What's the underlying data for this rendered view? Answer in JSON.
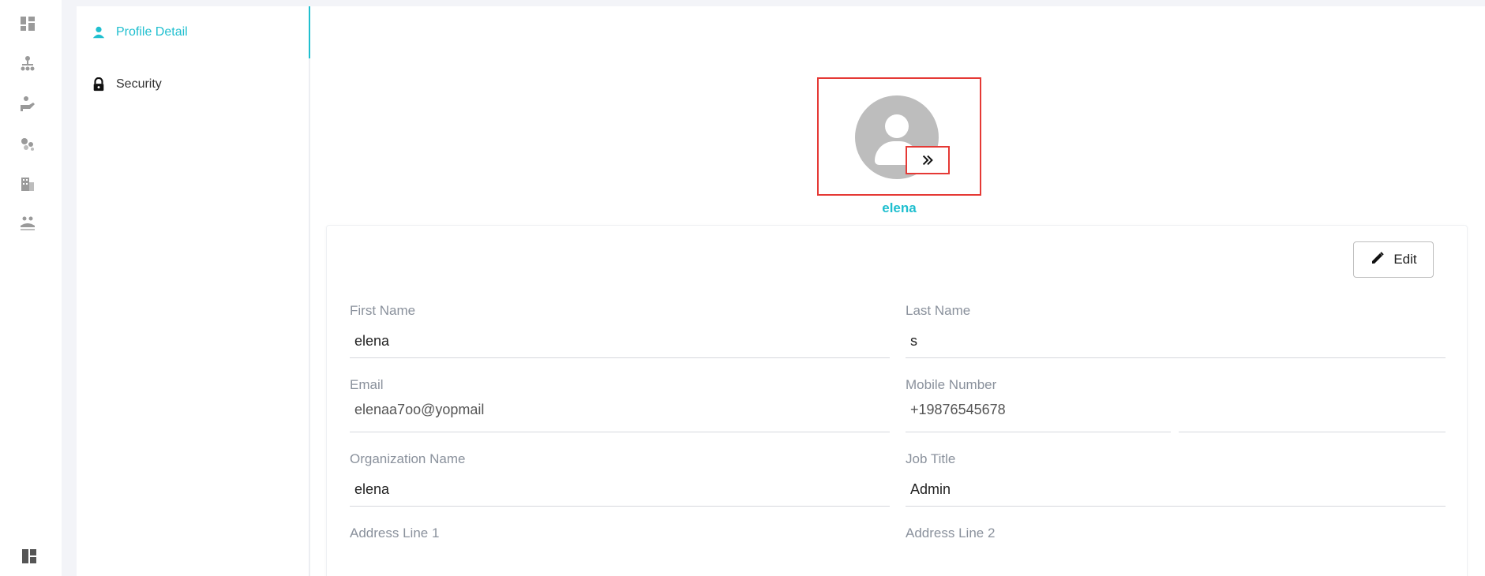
{
  "rail": {
    "icons": [
      "dashboard-icon",
      "org-chart-icon",
      "hand-care-icon",
      "bubbles-icon",
      "building-icon",
      "people-hand-icon"
    ],
    "bottom_icon": "layout-panel-icon"
  },
  "side_menu": {
    "items": [
      {
        "label": "Profile Detail",
        "icon": "person-icon",
        "active": true
      },
      {
        "label": "Security",
        "icon": "lock-icon",
        "active": false
      }
    ]
  },
  "profile": {
    "username": "elena",
    "edit_label": "Edit"
  },
  "form": {
    "first_name": {
      "label": "First Name",
      "value": "elena"
    },
    "last_name": {
      "label": "Last Name",
      "value": "s"
    },
    "email": {
      "label": "Email",
      "value": "elenaa7oo@yopmail"
    },
    "mobile": {
      "label": "Mobile Number",
      "value": "+19876545678"
    },
    "organization": {
      "label": "Organization Name",
      "value": "elena"
    },
    "job_title": {
      "label": "Job Title",
      "value": "Admin"
    },
    "address1": {
      "label": "Address Line 1",
      "value": ""
    },
    "address2": {
      "label": "Address Line 2",
      "value": ""
    }
  },
  "colors": {
    "accent": "#1fbfcf",
    "highlight_border": "#e53935",
    "rail_icon": "#9a9a9a"
  }
}
